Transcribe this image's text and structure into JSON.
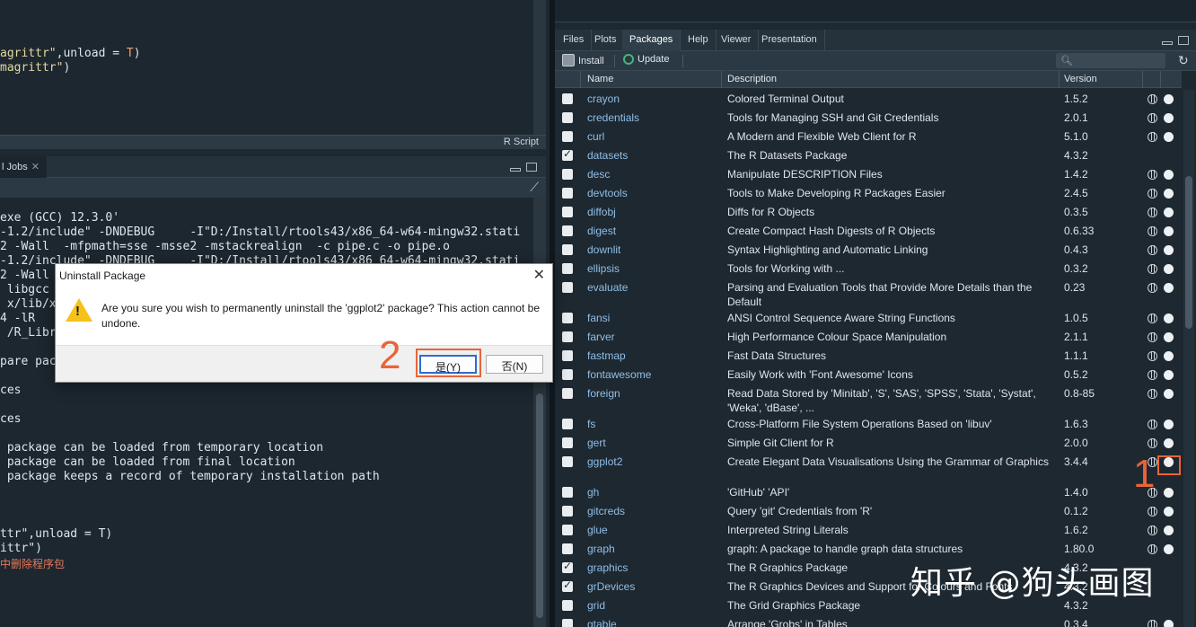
{
  "editor": {
    "lines": [
      {
        "pre": "",
        "str": "agrittr\"",
        "mid": ",unload = ",
        "kw": "T",
        "post": ")"
      },
      {
        "pre": "",
        "str": "magrittr\"",
        "mid": "",
        "kw": "",
        "post": ")"
      }
    ],
    "mode": "R Script"
  },
  "console": {
    "tab_label": "l Jobs",
    "lines": [
      "exe (GCC) 12.3.0'",
      "-1.2/include\" -DNDEBUG     -I\"D:/Install/rtools43/x86_64-w64-mingw32.stati",
      "2 -Wall  -mfpmath=sse -msse2 -mstackrealign  -c pipe.c -o pipe.o",
      "-1.2/include\" -DNDEBUG     -I\"D:/Install/rtools43/x86_64-w64-mingw32.stati",
      "2 -Wall",
      " libgcc -L",
      " x/lib/x",
      "4 -lR",
      " /R_Libr",
      "",
      "pare pack",
      "",
      "ces",
      "",
      "ces",
      "",
      " package can be loaded from temporary location",
      " package can be loaded from final location",
      " package keeps a record of temporary installation path",
      "",
      "",
      "",
      "ttr\",unload = T)",
      "ittr\")"
    ],
    "red_line": "中删除程序包"
  },
  "tabs": [
    "Files",
    "Plots",
    "Packages",
    "Help",
    "Viewer",
    "Presentation"
  ],
  "active_tab": "Packages",
  "toolbar": {
    "install": "Install",
    "update": "Update",
    "search_placeholder": ""
  },
  "table": {
    "headers": [
      "Name",
      "Description",
      "Version"
    ],
    "rows": [
      {
        "name": "crayon",
        "desc": "Colored Terminal Output",
        "ver": "1.5.2",
        "checked": false,
        "icons": true
      },
      {
        "name": "credentials",
        "desc": "Tools for Managing SSH and Git Credentials",
        "ver": "2.0.1",
        "checked": false,
        "icons": true
      },
      {
        "name": "curl",
        "desc": "A Modern and Flexible Web Client for R",
        "ver": "5.1.0",
        "checked": false,
        "icons": true
      },
      {
        "name": "datasets",
        "desc": "The R Datasets Package",
        "ver": "4.3.2",
        "checked": true,
        "icons": false
      },
      {
        "name": "desc",
        "desc": "Manipulate DESCRIPTION Files",
        "ver": "1.4.2",
        "checked": false,
        "icons": true
      },
      {
        "name": "devtools",
        "desc": "Tools to Make Developing R Packages Easier",
        "ver": "2.4.5",
        "checked": false,
        "icons": true
      },
      {
        "name": "diffobj",
        "desc": "Diffs for R Objects",
        "ver": "0.3.5",
        "checked": false,
        "icons": true
      },
      {
        "name": "digest",
        "desc": "Create Compact Hash Digests of R Objects",
        "ver": "0.6.33",
        "checked": false,
        "icons": true
      },
      {
        "name": "downlit",
        "desc": "Syntax Highlighting and Automatic Linking",
        "ver": "0.4.3",
        "checked": false,
        "icons": true
      },
      {
        "name": "ellipsis",
        "desc": "Tools for Working with ...",
        "ver": "0.3.2",
        "checked": false,
        "icons": true
      },
      {
        "name": "evaluate",
        "desc": "Parsing and Evaluation Tools that Provide More Details than the Default",
        "ver": "0.23",
        "checked": false,
        "icons": true
      },
      {
        "name": "fansi",
        "desc": "ANSI Control Sequence Aware String Functions",
        "ver": "1.0.5",
        "checked": false,
        "icons": true
      },
      {
        "name": "farver",
        "desc": "High Performance Colour Space Manipulation",
        "ver": "2.1.1",
        "checked": false,
        "icons": true
      },
      {
        "name": "fastmap",
        "desc": "Fast Data Structures",
        "ver": "1.1.1",
        "checked": false,
        "icons": true
      },
      {
        "name": "fontawesome",
        "desc": "Easily Work with 'Font Awesome' Icons",
        "ver": "0.5.2",
        "checked": false,
        "icons": true
      },
      {
        "name": "foreign",
        "desc": "Read Data Stored by 'Minitab', 'S', 'SAS', 'SPSS', 'Stata', 'Systat', 'Weka', 'dBase', ...",
        "ver": "0.8-85",
        "checked": false,
        "icons": true
      },
      {
        "name": "fs",
        "desc": "Cross-Platform File System Operations Based on 'libuv'",
        "ver": "1.6.3",
        "checked": false,
        "icons": true
      },
      {
        "name": "gert",
        "desc": "Simple Git Client for R",
        "ver": "2.0.0",
        "checked": false,
        "icons": true
      },
      {
        "name": "ggplot2",
        "desc": "Create Elegant Data Visualisations Using the Grammar of Graphics",
        "ver": "3.4.4",
        "checked": false,
        "icons": true
      },
      {
        "name": "gh",
        "desc": "'GitHub' 'API'",
        "ver": "1.4.0",
        "checked": false,
        "icons": true
      },
      {
        "name": "gitcreds",
        "desc": "Query 'git' Credentials from 'R'",
        "ver": "0.1.2",
        "checked": false,
        "icons": true
      },
      {
        "name": "glue",
        "desc": "Interpreted String Literals",
        "ver": "1.6.2",
        "checked": false,
        "icons": true
      },
      {
        "name": "graph",
        "desc": "graph: A package to handle graph data structures",
        "ver": "1.80.0",
        "checked": false,
        "icons": true
      },
      {
        "name": "graphics",
        "desc": "The R Graphics Package",
        "ver": "4.3.2",
        "checked": true,
        "icons": false
      },
      {
        "name": "grDevices",
        "desc": "The R Graphics Devices and Support for Colours and Fonts",
        "ver": "4.3.2",
        "checked": true,
        "icons": false
      },
      {
        "name": "grid",
        "desc": "The Grid Graphics Package",
        "ver": "4.3.2",
        "checked": false,
        "icons": false
      },
      {
        "name": "gtable",
        "desc": "Arrange 'Grobs' in Tables",
        "ver": "0.3.4",
        "checked": false,
        "icons": true
      }
    ]
  },
  "dialog": {
    "title": "Uninstall Package",
    "message": "Are you sure you wish to permanently uninstall the 'ggplot2' package? This action cannot be undone.",
    "yes": "是(Y)",
    "no": "否(N)"
  },
  "annotations": {
    "step1": "1",
    "step2": "2",
    "color": "#e8643a"
  },
  "watermark": "知乎 @狗头画图"
}
